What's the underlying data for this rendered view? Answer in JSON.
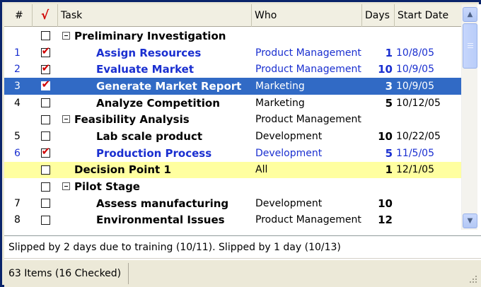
{
  "columns": {
    "num": "#",
    "check": "√",
    "task": "Task",
    "who": "Who",
    "days": "Days",
    "start": "Start Date"
  },
  "rows": [
    {
      "num": "",
      "checked": false,
      "group": true,
      "indent": 1,
      "task": "Preliminary Investigation",
      "who": "",
      "days": "",
      "start": "",
      "style": "normal"
    },
    {
      "num": "1",
      "checked": true,
      "group": false,
      "indent": 2,
      "task": "Assign Resources",
      "who": "Product Management",
      "days": "1",
      "start": "10/8/05",
      "style": "blue"
    },
    {
      "num": "2",
      "checked": true,
      "group": false,
      "indent": 2,
      "task": "Evaluate Market",
      "who": "Product Management",
      "days": "10",
      "start": "10/9/05",
      "style": "blue"
    },
    {
      "num": "3",
      "checked": true,
      "group": false,
      "indent": 2,
      "task": "Generate Market Report",
      "who": "Marketing",
      "days": "3",
      "start": "10/9/05",
      "style": "selected"
    },
    {
      "num": "4",
      "checked": false,
      "group": false,
      "indent": 2,
      "task": "Analyze Competition",
      "who": "Marketing",
      "days": "5",
      "start": "10/12/05",
      "style": "normal"
    },
    {
      "num": "",
      "checked": false,
      "group": true,
      "indent": 1,
      "task": "Feasibility Analysis",
      "who": "Product Management",
      "days": "",
      "start": "",
      "style": "normal"
    },
    {
      "num": "5",
      "checked": false,
      "group": false,
      "indent": 2,
      "task": "Lab scale product",
      "who": "Development",
      "days": "10",
      "start": "10/22/05",
      "style": "normal"
    },
    {
      "num": "6",
      "checked": true,
      "group": false,
      "indent": 2,
      "task": "Production Process",
      "who": "Development",
      "days": "5",
      "start": "11/5/05",
      "style": "blue"
    },
    {
      "num": "",
      "checked": false,
      "group": false,
      "indent": 1,
      "task": "Decision Point 1",
      "who": "All",
      "days": "1",
      "start": "12/1/05",
      "style": "yellow"
    },
    {
      "num": "",
      "checked": false,
      "group": true,
      "indent": 1,
      "task": "Pilot Stage",
      "who": "",
      "days": "",
      "start": "",
      "style": "normal"
    },
    {
      "num": "7",
      "checked": false,
      "group": false,
      "indent": 2,
      "task": "Assess manufacturing",
      "who": "Development",
      "days": "10",
      "start": "",
      "style": "normal"
    },
    {
      "num": "8",
      "checked": false,
      "group": false,
      "indent": 2,
      "task": "Environmental Issues",
      "who": "Product Management",
      "days": "12",
      "start": "",
      "style": "normal"
    }
  ],
  "note": "Slipped by 2 days due to training (10/11).  Slipped by 1 day (10/13)",
  "status": "63 Items (16 Checked)",
  "scrollbar": {
    "position": 0.0
  },
  "colors": {
    "selection": "#316ac5",
    "highlight_row": "#ffffa0",
    "link_text": "#1a2fd0",
    "check_mark": "#d00000"
  }
}
